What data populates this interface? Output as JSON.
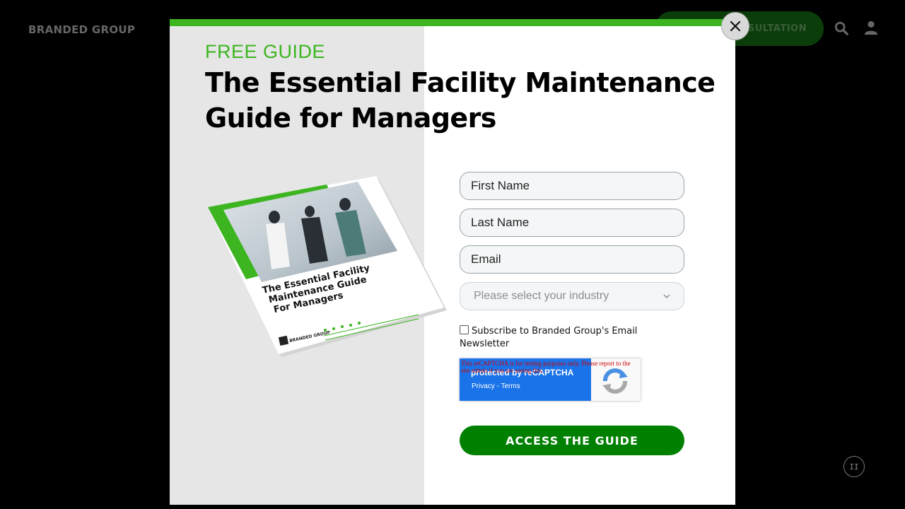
{
  "background": {
    "site_logo": "BRANDED GROUP",
    "cta_label": "SULTATION",
    "pause_glyph": "II"
  },
  "modal": {
    "eyebrow": "FREE GUIDE",
    "headline": "The Essential Facility Maintenance Guide for Managers",
    "book": {
      "title_line1": "The Essential Facility",
      "title_line2": "Maintenance Guide",
      "title_line3": "For Managers",
      "logo_text": "BRANDED GROUP"
    },
    "form": {
      "first_name_placeholder": "First Name",
      "last_name_placeholder": "Last Name",
      "email_placeholder": "Email",
      "industry_placeholder": "Please select your industry",
      "subscribe_label": "Subscribe to Branded Group's Email Newsletter",
      "recaptcha_warning": "This reCAPTCHA is for testing purposes only. Please report to the site admin if you are seeing this.",
      "recaptcha_protected": "protected by reCAPTCHA",
      "recaptcha_terms": "Privacy - Terms",
      "submit_label": "ACCESS THE GUIDE"
    },
    "close_icon": "close-icon"
  },
  "colors": {
    "accent_green": "#3cb520",
    "button_green": "#008000",
    "recaptcha_blue": "#1a73e8"
  }
}
